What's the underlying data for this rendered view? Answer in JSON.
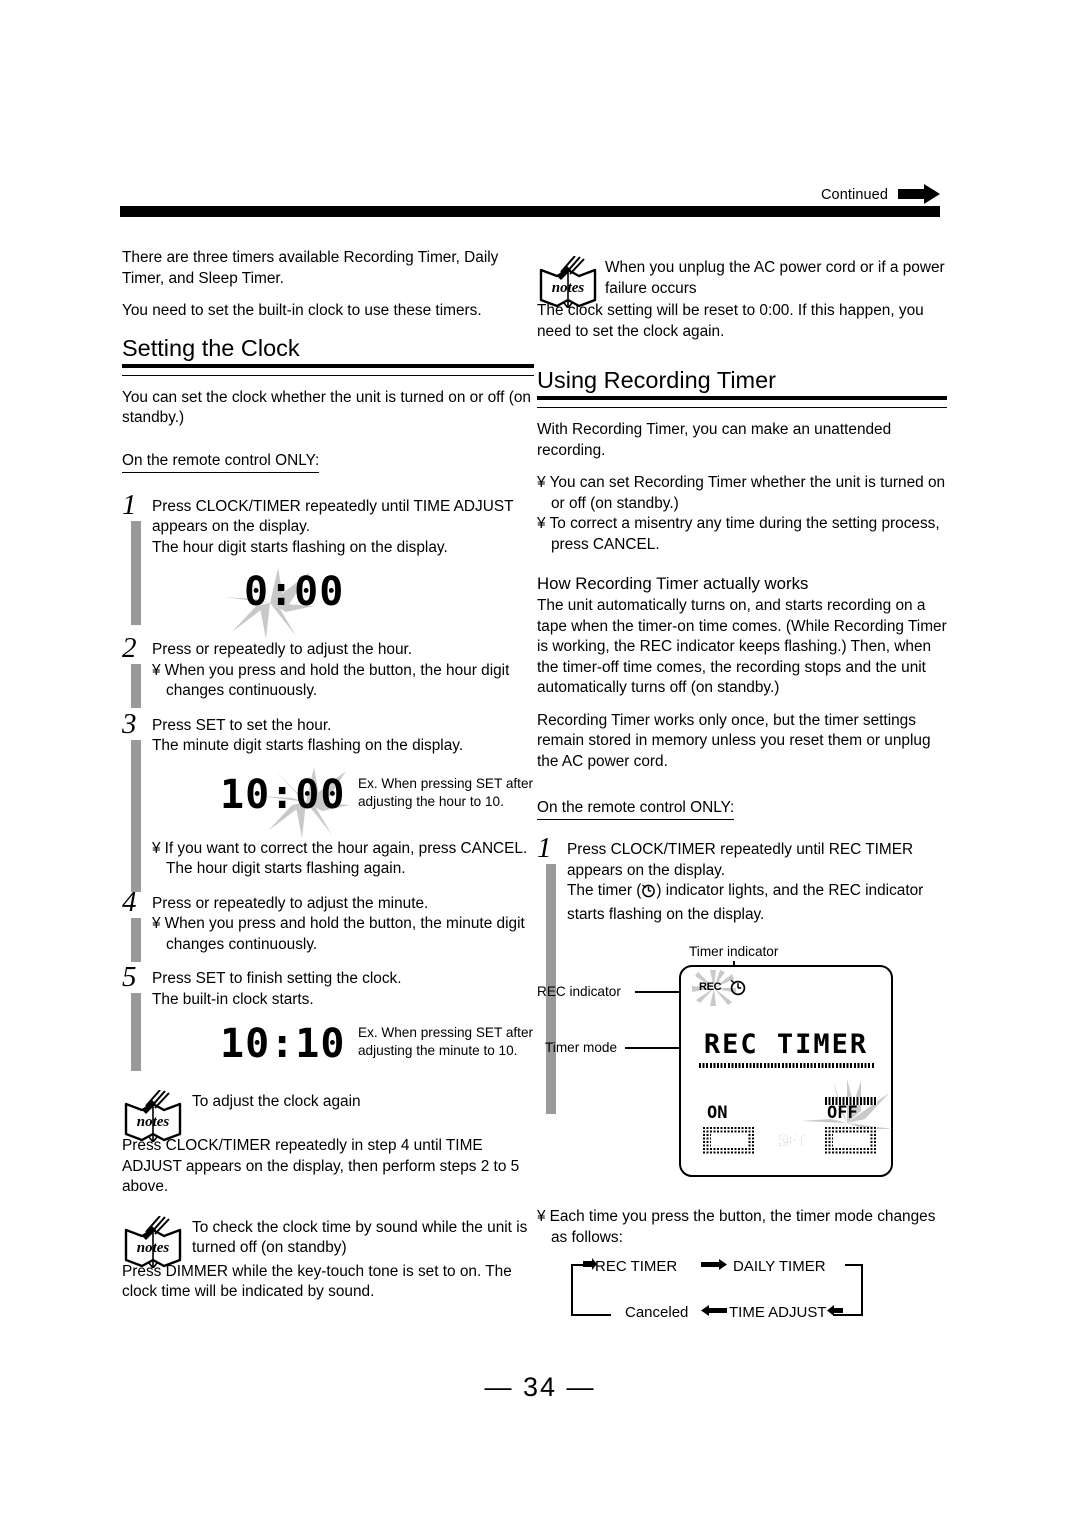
{
  "header": {
    "continued_label": "Continued",
    "continued_icon": "right-arrow-icon"
  },
  "left_column": {
    "intro_paragraph_1": "There are three timers available Recording Timer, Daily Timer, and Sleep Timer.",
    "intro_paragraph_2": "You need to set the built-in clock to use these timers.",
    "section_title": "Setting the Clock",
    "section_intro": "You can set the clock whether the unit is turned on or off (on standby.)",
    "remote_only_label": "On the remote control ONLY:",
    "steps": [
      {
        "number": "1",
        "line1": "Press CLOCK/TIMER repeatedly until  TIME ADJUST  appears on the display.",
        "line2": "The hour digit starts flashing on the display."
      },
      {
        "number": "2",
        "line1": "Press       or       repeatedly to adjust the hour.",
        "bullet": "When you press and hold the button, the hour digit changes continuously."
      },
      {
        "number": "3",
        "line1": "Press SET to set the hour.",
        "line2": "The minute digit starts flashing on the display.",
        "bullet": "If you want to correct the hour again, press CANCEL.",
        "bullet_extra": "The hour digit starts flashing again."
      },
      {
        "number": "4",
        "line1": "Press       or       repeatedly to adjust the minute.",
        "bullet": "When you press and hold the button, the minute digit changes continuously."
      },
      {
        "number": "5",
        "line1": "Press SET to finish setting the clock.",
        "line2": "The built-in clock starts."
      }
    ],
    "lcd_clock_1": "0:00",
    "lcd_clock_2": "10:00",
    "lcd_clock_2_caption": "Ex. When pressing SET after adjusting the hour to 10.",
    "lcd_clock_3": "10:10",
    "lcd_clock_3_caption": "Ex. When pressing SET after adjusting the minute to 10.",
    "notes": [
      {
        "icon": "notes-book-icon",
        "heading": "To adjust the clock again",
        "body": "Press CLOCK/TIMER repeatedly in step 4 until  TIME ADJUST appears on the display, then perform steps 2 to 5 above."
      },
      {
        "icon": "notes-book-icon",
        "heading": "To check the clock time by sound while the unit is turned off (on standby)",
        "body": "Press DIMMER while the key-touch tone is set to on. The clock time will be indicated by sound."
      }
    ]
  },
  "right_column": {
    "top_note": {
      "icon": "notes-book-icon",
      "heading": "When you unplug the AC power cord or if a power failure occurs",
      "body": "The clock setting will be reset to  0:00.  If this happen, you need to set the clock again."
    },
    "section_title": "Using Recording Timer",
    "intro": "With Recording Timer, you can make an unattended recording.",
    "bullets": [
      "You can set Recording Timer whether the unit is turned on or off (on standby.)",
      "To correct a misentry any time during the setting process, press CANCEL."
    ],
    "sub_head": "How Recording Timer actually works",
    "paragraph_1": "The unit automatically turns on, and starts recording on a tape when the timer-on time comes. (While Recording Timer is working, the REC indicator keeps flashing.) Then, when the timer-off time comes, the recording stops and the unit automatically turns off (on standby.)",
    "paragraph_2": "Recording Timer works only once, but the timer settings remain stored in memory unless you reset them or unplug the AC power cord.",
    "remote_only_label": "On the remote control ONLY:",
    "step1": {
      "number": "1",
      "line1": "Press CLOCK/TIMER repeatedly until  REC TIMER  appears on the display.",
      "line2": "The timer ( ) indicator lights, and the REC indicator starts flashing on the display."
    },
    "lcd_figure": {
      "callout_timer_indicator": "Timer indicator",
      "callout_rec_indicator": "REC indicator",
      "callout_timer_mode": "Timer mode",
      "rec_text": "REC",
      "timer_glyph_name": "clock-timer-icon",
      "mode_text": "REC TIMER",
      "on_label": "ON",
      "off_label": "OFF",
      "set_label": "SET"
    },
    "mode_cycle_bullet": "Each time you press the button, the timer mode changes as follows:",
    "mode_cycle": {
      "item1": "REC TIMER",
      "item2": "DAILY TIMER",
      "item3": "TIME ADJUST",
      "item4": "Canceled"
    }
  },
  "footer": {
    "page_number": "— 34 —"
  }
}
